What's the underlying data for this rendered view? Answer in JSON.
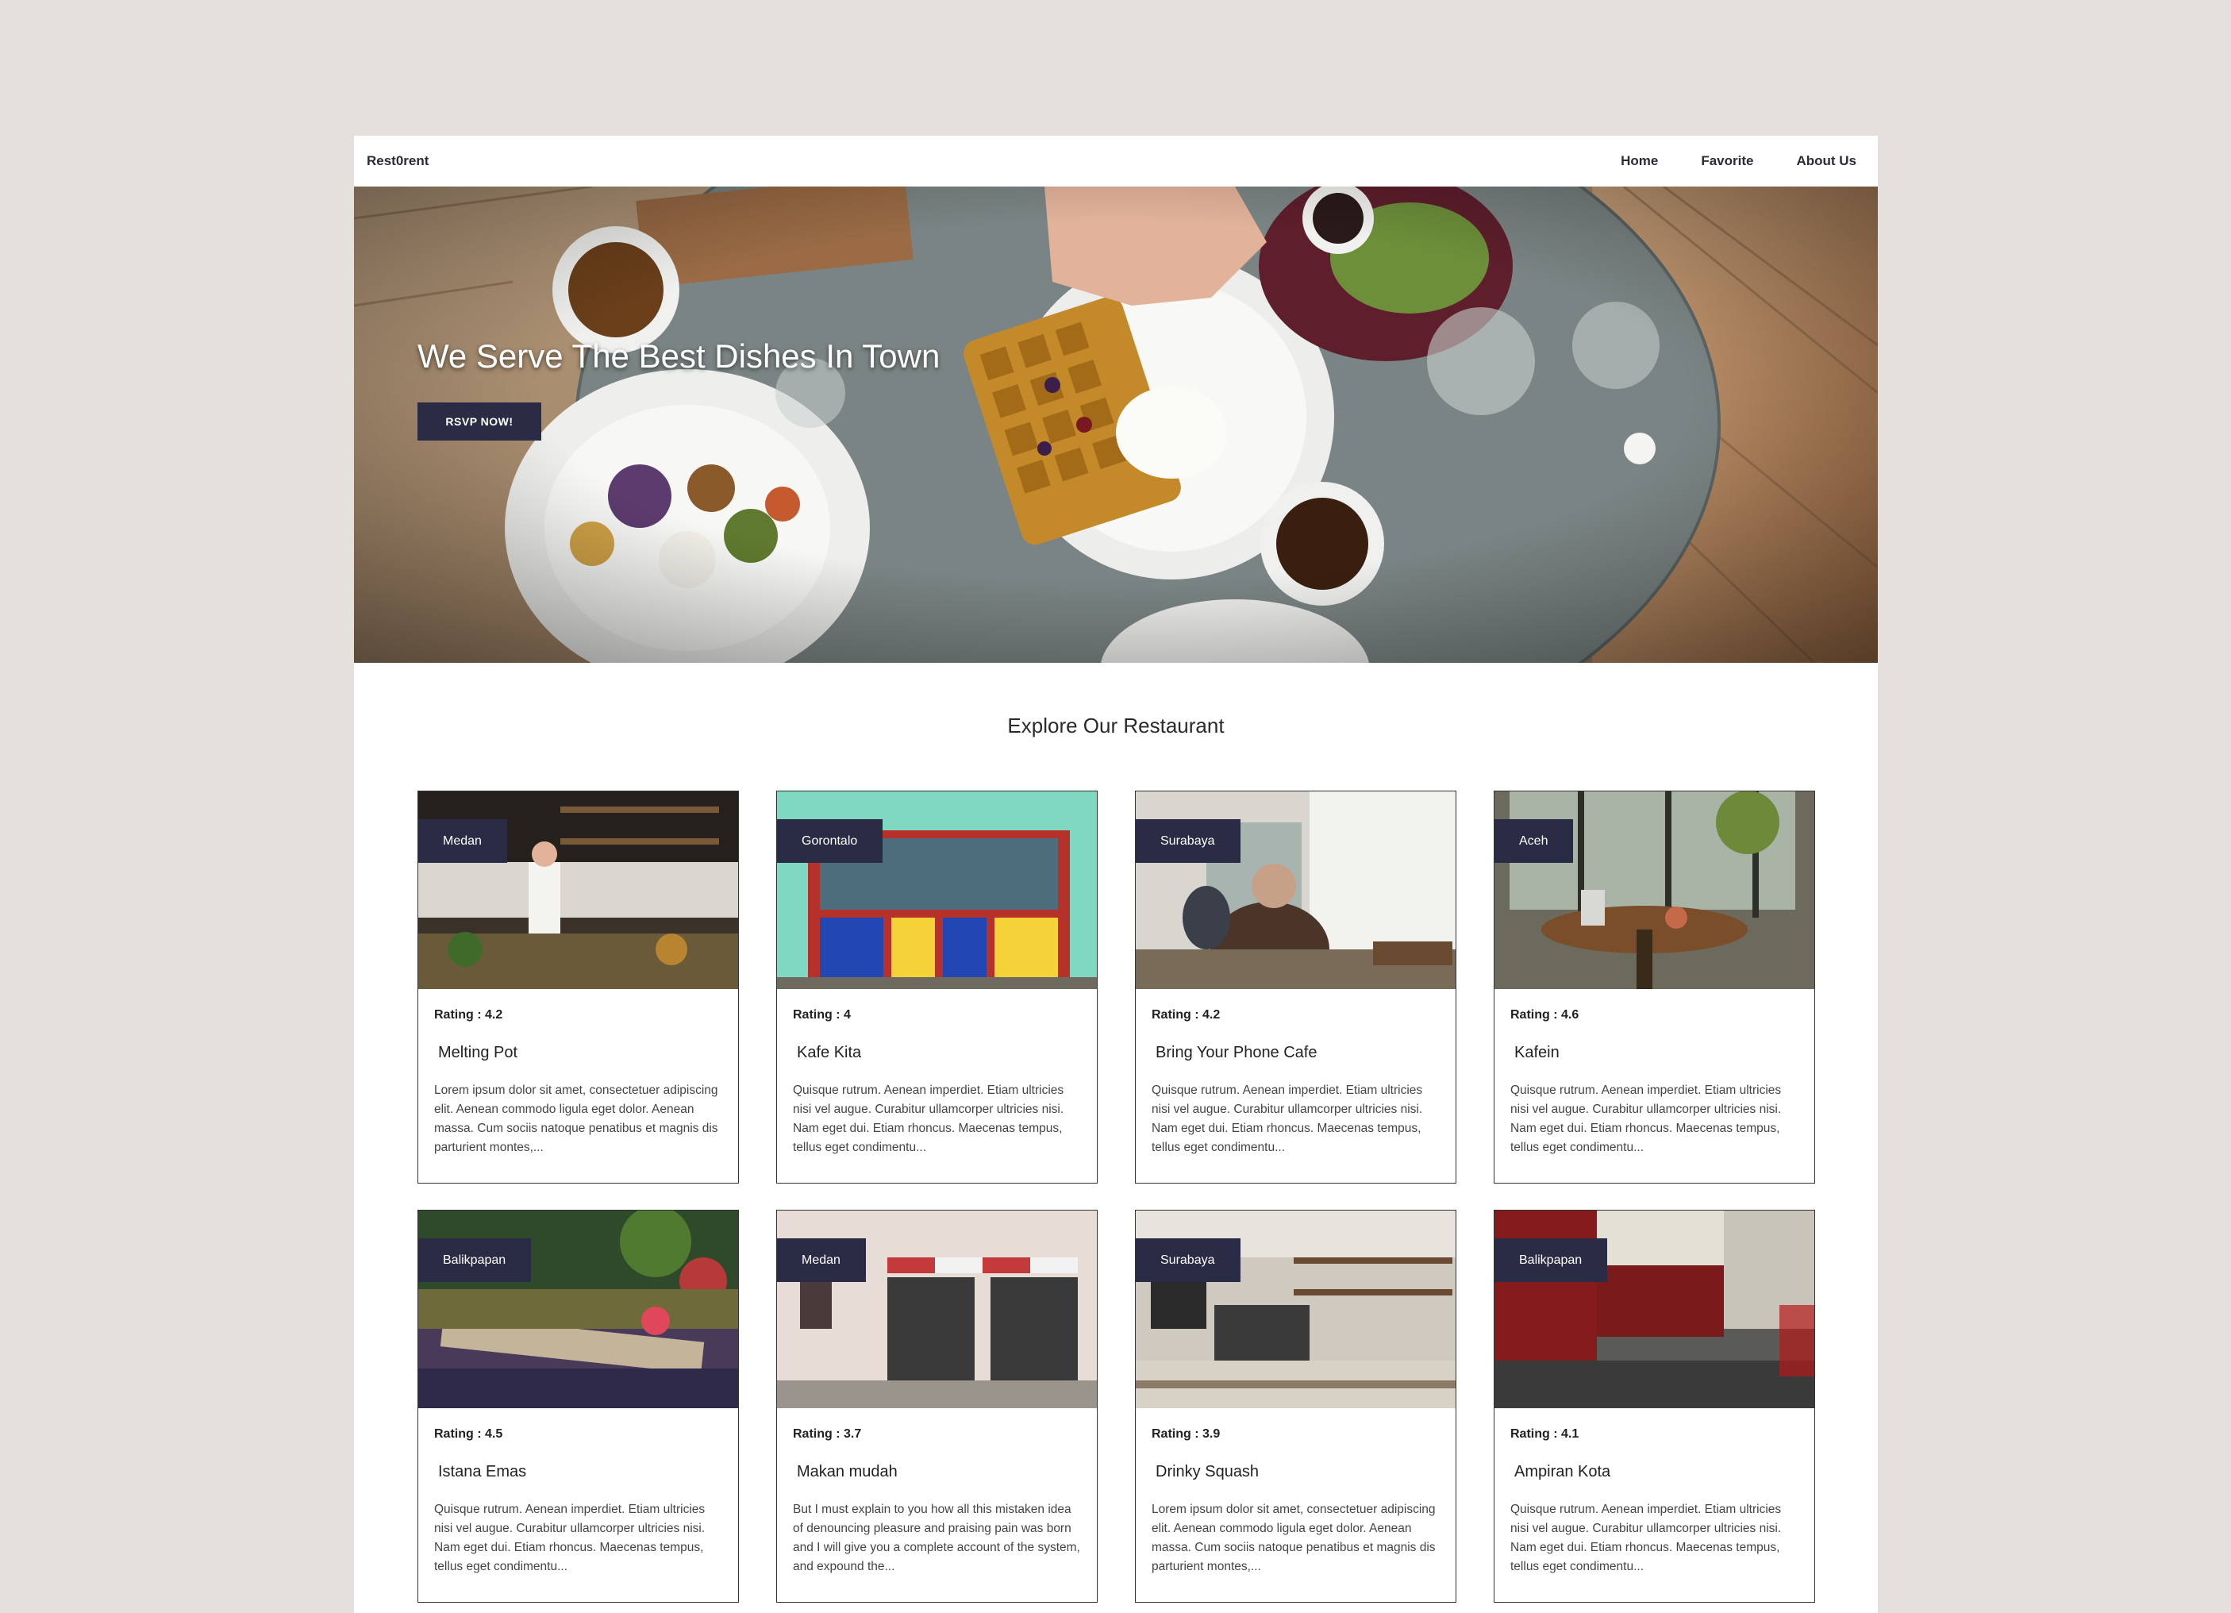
{
  "navbar": {
    "brand": "Rest0rent",
    "links": [
      "Home",
      "Favorite",
      "About Us"
    ]
  },
  "hero": {
    "title": "We Serve The Best Dishes In Town",
    "button_label": "RSVP NOW!"
  },
  "section_title": "Explore Our Restaurant",
  "restaurants": [
    {
      "city": "Medan",
      "rating": "Rating : 4.2",
      "name": "Melting Pot",
      "description": "Lorem ipsum dolor sit amet, consectetuer adipiscing elit. Aenean commodo ligula eget dolor. Aenean massa. Cum sociis natoque penatibus et magnis dis parturient montes,..."
    },
    {
      "city": "Gorontalo",
      "rating": "Rating : 4",
      "name": "Kafe Kita",
      "description": "Quisque rutrum. Aenean imperdiet. Etiam ultricies nisi vel augue. Curabitur ullamcorper ultricies nisi. Nam eget dui. Etiam rhoncus. Maecenas tempus, tellus eget condimentu..."
    },
    {
      "city": "Surabaya",
      "rating": "Rating : 4.2",
      "name": "Bring Your Phone Cafe",
      "description": "Quisque rutrum. Aenean imperdiet. Etiam ultricies nisi vel augue. Curabitur ullamcorper ultricies nisi. Nam eget dui. Etiam rhoncus. Maecenas tempus, tellus eget condimentu..."
    },
    {
      "city": "Aceh",
      "rating": "Rating : 4.6",
      "name": "Kafein",
      "description": "Quisque rutrum. Aenean imperdiet. Etiam ultricies nisi vel augue. Curabitur ullamcorper ultricies nisi. Nam eget dui. Etiam rhoncus. Maecenas tempus, tellus eget condimentu..."
    },
    {
      "city": "Balikpapan",
      "rating": "Rating : 4.5",
      "name": "Istana Emas",
      "description": "Quisque rutrum. Aenean imperdiet. Etiam ultricies nisi vel augue. Curabitur ullamcorper ultricies nisi. Nam eget dui. Etiam rhoncus. Maecenas tempus, tellus eget condimentu..."
    },
    {
      "city": "Medan",
      "rating": "Rating : 3.7",
      "name": "Makan mudah",
      "description": "But I must explain to you how all this mistaken idea of denouncing pleasure and praising pain was born and I will give you a complete account of the system, and expound the..."
    },
    {
      "city": "Surabaya",
      "rating": "Rating : 3.9",
      "name": "Drinky Squash",
      "description": "Lorem ipsum dolor sit amet, consectetuer adipiscing elit. Aenean commodo ligula eget dolor. Aenean massa. Cum sociis natoque penatibus et magnis dis parturient montes,..."
    },
    {
      "city": "Balikpapan",
      "rating": "Rating : 4.1",
      "name": "Ampiran Kota",
      "description": "Quisque rutrum. Aenean imperdiet. Etiam ultricies nisi vel augue. Curabitur ullamcorper ultricies nisi. Nam eget dui. Etiam rhoncus. Maecenas tempus, tellus eget condimentu..."
    }
  ]
}
